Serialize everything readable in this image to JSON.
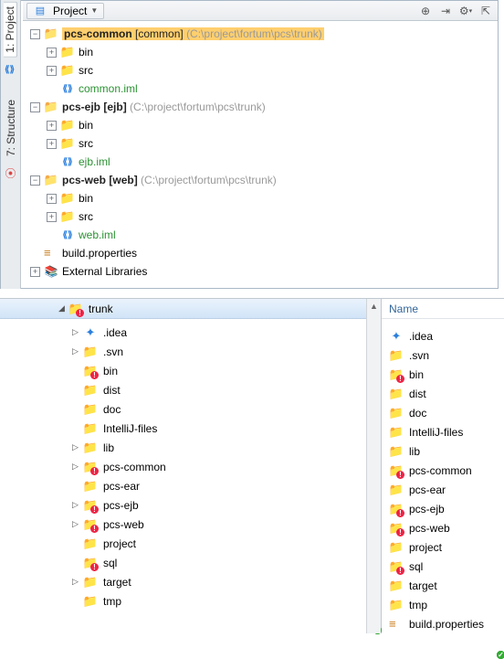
{
  "toolbar": {
    "view_label": "Project"
  },
  "sidebar": {
    "tab_project": "1: Project",
    "tab_structure": "7: Structure"
  },
  "project_tree": {
    "pcs_common": {
      "name": "pcs-common",
      "type": "[common]",
      "path": "(C:\\project\\fortum\\pcs\\trunk)"
    },
    "pcs_ejb": {
      "name": "pcs-ejb",
      "type": "[ejb]",
      "path": "(C:\\project\\fortum\\pcs\\trunk)"
    },
    "pcs_web": {
      "name": "pcs-web",
      "type": "[web]",
      "path": "(C:\\project\\fortum\\pcs\\trunk)"
    },
    "bin": "bin",
    "src": "src",
    "common_iml": "common.iml",
    "ejb_iml": "ejb.iml",
    "web_iml": "web.iml",
    "build_properties": "build.properties",
    "external_libraries": "External Libraries"
  },
  "fs_tree": {
    "root": "trunk",
    "items": [
      {
        "label": ".idea",
        "icon": "idea",
        "expandable": true
      },
      {
        "label": ".svn",
        "icon": "svn",
        "expandable": true
      },
      {
        "label": "bin",
        "icon": "err",
        "expandable": false
      },
      {
        "label": "dist",
        "icon": "plain",
        "expandable": false
      },
      {
        "label": "doc",
        "icon": "ok",
        "expandable": false
      },
      {
        "label": "IntelliJ-files",
        "icon": "ok",
        "expandable": false
      },
      {
        "label": "lib",
        "icon": "ok",
        "expandable": true
      },
      {
        "label": "pcs-common",
        "icon": "err",
        "expandable": true
      },
      {
        "label": "pcs-ear",
        "icon": "ok",
        "expandable": false
      },
      {
        "label": "pcs-ejb",
        "icon": "err",
        "expandable": true
      },
      {
        "label": "pcs-web",
        "icon": "err",
        "expandable": true
      },
      {
        "label": "project",
        "icon": "plain",
        "expandable": false
      },
      {
        "label": "sql",
        "icon": "err",
        "expandable": false
      },
      {
        "label": "target",
        "icon": "ok",
        "expandable": true
      },
      {
        "label": "tmp",
        "icon": "plain",
        "expandable": false
      }
    ]
  },
  "details": {
    "header": "Name",
    "rows": [
      {
        "label": ".idea",
        "icon": "idea"
      },
      {
        "label": ".svn",
        "icon": "svn"
      },
      {
        "label": "bin",
        "icon": "err"
      },
      {
        "label": "dist",
        "icon": "plain"
      },
      {
        "label": "doc",
        "icon": "ok"
      },
      {
        "label": "IntelliJ-files",
        "icon": "ok"
      },
      {
        "label": "lib",
        "icon": "ok"
      },
      {
        "label": "pcs-common",
        "icon": "err"
      },
      {
        "label": "pcs-ear",
        "icon": "ok"
      },
      {
        "label": "pcs-ejb",
        "icon": "err"
      },
      {
        "label": "pcs-web",
        "icon": "err"
      },
      {
        "label": "project",
        "icon": "plain"
      },
      {
        "label": "sql",
        "icon": "err"
      },
      {
        "label": "target",
        "icon": "ok"
      },
      {
        "label": "tmp",
        "icon": "plain"
      },
      {
        "label": "build.properties",
        "icon": "props"
      }
    ]
  }
}
